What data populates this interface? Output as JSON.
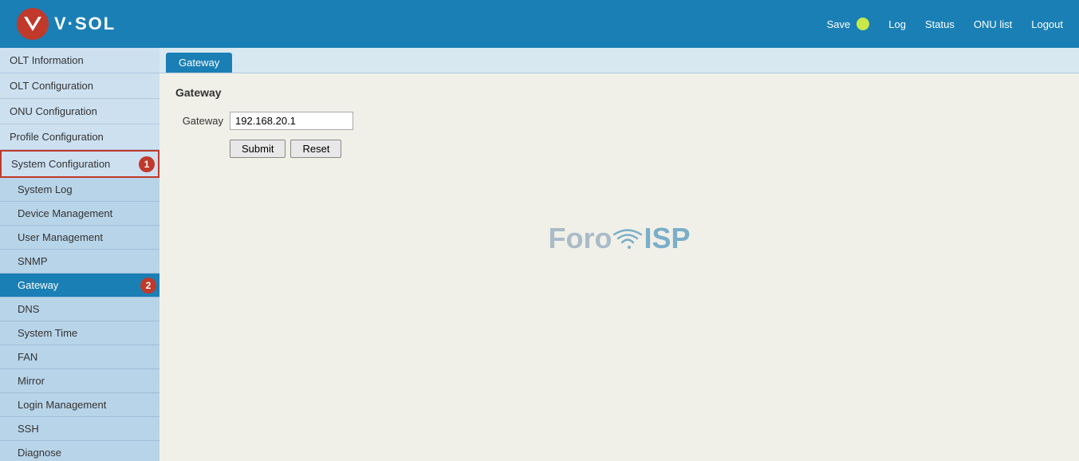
{
  "header": {
    "logo_text": "V·SOL",
    "save_label": "Save",
    "status_dot_color": "#c8e84a",
    "log_label": "Log",
    "status_label": "Status",
    "onu_list_label": "ONU list",
    "logout_label": "Logout"
  },
  "sidebar": {
    "main_items": [
      {
        "id": "olt-info",
        "label": "OLT Information",
        "active": false,
        "badge": null
      },
      {
        "id": "olt-config",
        "label": "OLT Configuration",
        "active": false,
        "badge": null
      },
      {
        "id": "onu-config",
        "label": "ONU Configuration",
        "active": false,
        "badge": null
      },
      {
        "id": "profile-config",
        "label": "Profile Configuration",
        "active": false,
        "badge": null
      },
      {
        "id": "system-config",
        "label": "System Configuration",
        "active": true,
        "badge": "1"
      }
    ],
    "sub_items": [
      {
        "id": "system-log",
        "label": "System Log",
        "active": false
      },
      {
        "id": "device-mgmt",
        "label": "Device Management",
        "active": false
      },
      {
        "id": "user-mgmt",
        "label": "User Management",
        "active": false
      },
      {
        "id": "snmp",
        "label": "SNMP",
        "active": false
      },
      {
        "id": "gateway",
        "label": "Gateway",
        "active": true,
        "badge": "2"
      },
      {
        "id": "dns",
        "label": "DNS",
        "active": false
      },
      {
        "id": "system-time",
        "label": "System Time",
        "active": false
      },
      {
        "id": "fan",
        "label": "FAN",
        "active": false
      },
      {
        "id": "mirror",
        "label": "Mirror",
        "active": false
      },
      {
        "id": "login-mgmt",
        "label": "Login Management",
        "active": false
      },
      {
        "id": "ssh",
        "label": "SSH",
        "active": false
      },
      {
        "id": "diagnose",
        "label": "Diagnose",
        "active": false
      }
    ]
  },
  "tab": {
    "label": "Gateway"
  },
  "content": {
    "title": "Gateway",
    "form": {
      "gateway_label": "Gateway",
      "gateway_value": "192.168.20.1",
      "gateway_placeholder": "",
      "submit_label": "Submit",
      "reset_label": "Reset"
    }
  },
  "watermark": {
    "text_foro": "Foro",
    "text_isp": "ISP"
  }
}
